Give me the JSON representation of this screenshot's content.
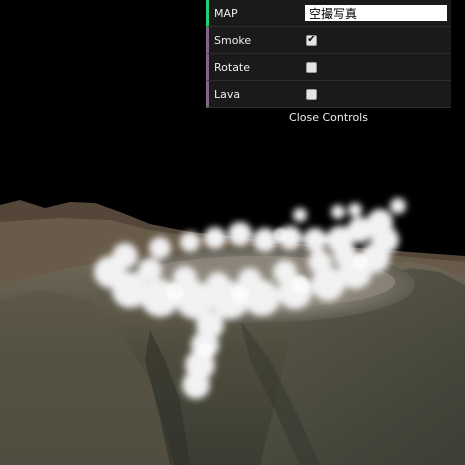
{
  "controls": {
    "map": {
      "label": "MAP",
      "value": "空撮写真"
    },
    "smoke": {
      "label": "Smoke",
      "checked": true,
      "mark": "✔"
    },
    "rotate": {
      "label": "Rotate",
      "checked": false,
      "mark": ""
    },
    "lava": {
      "label": "Lava",
      "checked": false,
      "mark": ""
    },
    "close_label": "Close Controls"
  },
  "colors": {
    "panel_bg": "#1a1a1a",
    "string_accent": "#1ed36f",
    "boolean_accent": "#806787",
    "sky": "#000000"
  }
}
